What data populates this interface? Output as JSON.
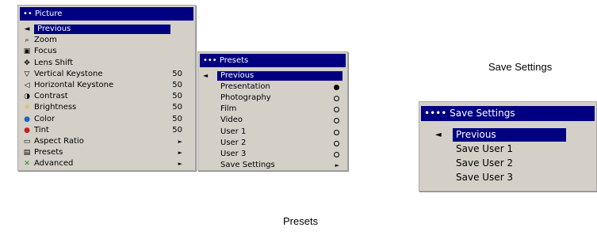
{
  "picture_menu": {
    "title": "•• Picture",
    "items": [
      {
        "icon": "◄",
        "icon_name": "left-arrow-icon",
        "label": "Previous",
        "value": "",
        "selected": true
      },
      {
        "icon": "⌕",
        "icon_name": "zoom-icon",
        "label": "Zoom",
        "value": ""
      },
      {
        "icon": "▣",
        "icon_name": "focus-icon",
        "label": "Focus",
        "value": ""
      },
      {
        "icon": "✥",
        "icon_name": "lens-shift-icon",
        "label": "Lens Shift",
        "value": ""
      },
      {
        "icon": "▽",
        "icon_name": "vertical-keystone-icon",
        "label": "Vertical Keystone",
        "value": "50"
      },
      {
        "icon": "◁",
        "icon_name": "horizontal-keystone-icon",
        "label": "Horizontal Keystone",
        "value": "50"
      },
      {
        "icon": "◑",
        "icon_name": "contrast-icon",
        "label": "Contrast",
        "value": "50"
      },
      {
        "icon": "☼",
        "icon_name": "brightness-icon",
        "label": "Brightness",
        "value": "50"
      },
      {
        "icon": "●",
        "icon_name": "color-icon",
        "label": "Color",
        "value": "50"
      },
      {
        "icon": "●",
        "icon_name": "tint-icon",
        "label": "Tint",
        "value": "50"
      },
      {
        "icon": "▭",
        "icon_name": "aspect-ratio-icon",
        "label": "Aspect Ratio",
        "value": "►"
      },
      {
        "icon": "▤",
        "icon_name": "presets-icon",
        "label": "Presets",
        "value": "►"
      },
      {
        "icon": "✕",
        "icon_name": "advanced-icon",
        "label": "Advanced",
        "value": "►"
      }
    ]
  },
  "presets_menu": {
    "title": "••• Presets",
    "items": [
      {
        "label": "Previous",
        "selected": true,
        "marker": "◄"
      },
      {
        "label": "Presentation",
        "radio": "on"
      },
      {
        "label": "Photography",
        "radio": "off"
      },
      {
        "label": "Film",
        "radio": "off"
      },
      {
        "label": "Video",
        "radio": "off"
      },
      {
        "label": "User 1",
        "radio": "off"
      },
      {
        "label": "User 2",
        "radio": "off"
      },
      {
        "label": "User 3",
        "radio": "off"
      },
      {
        "label": "Save Settings",
        "arrow": "►"
      }
    ]
  },
  "save_menu": {
    "title": "•••• Save Settings",
    "items": [
      {
        "label": "Previous",
        "selected": true,
        "marker": "◄"
      },
      {
        "label": "Save User 1"
      },
      {
        "label": "Save User 2"
      },
      {
        "label": "Save User 3"
      }
    ]
  },
  "captions": {
    "save_settings": "Save Settings",
    "presets": "Presets"
  },
  "colors": {
    "title_bg": "#000080",
    "menu_bg": "#d4d0c8"
  }
}
